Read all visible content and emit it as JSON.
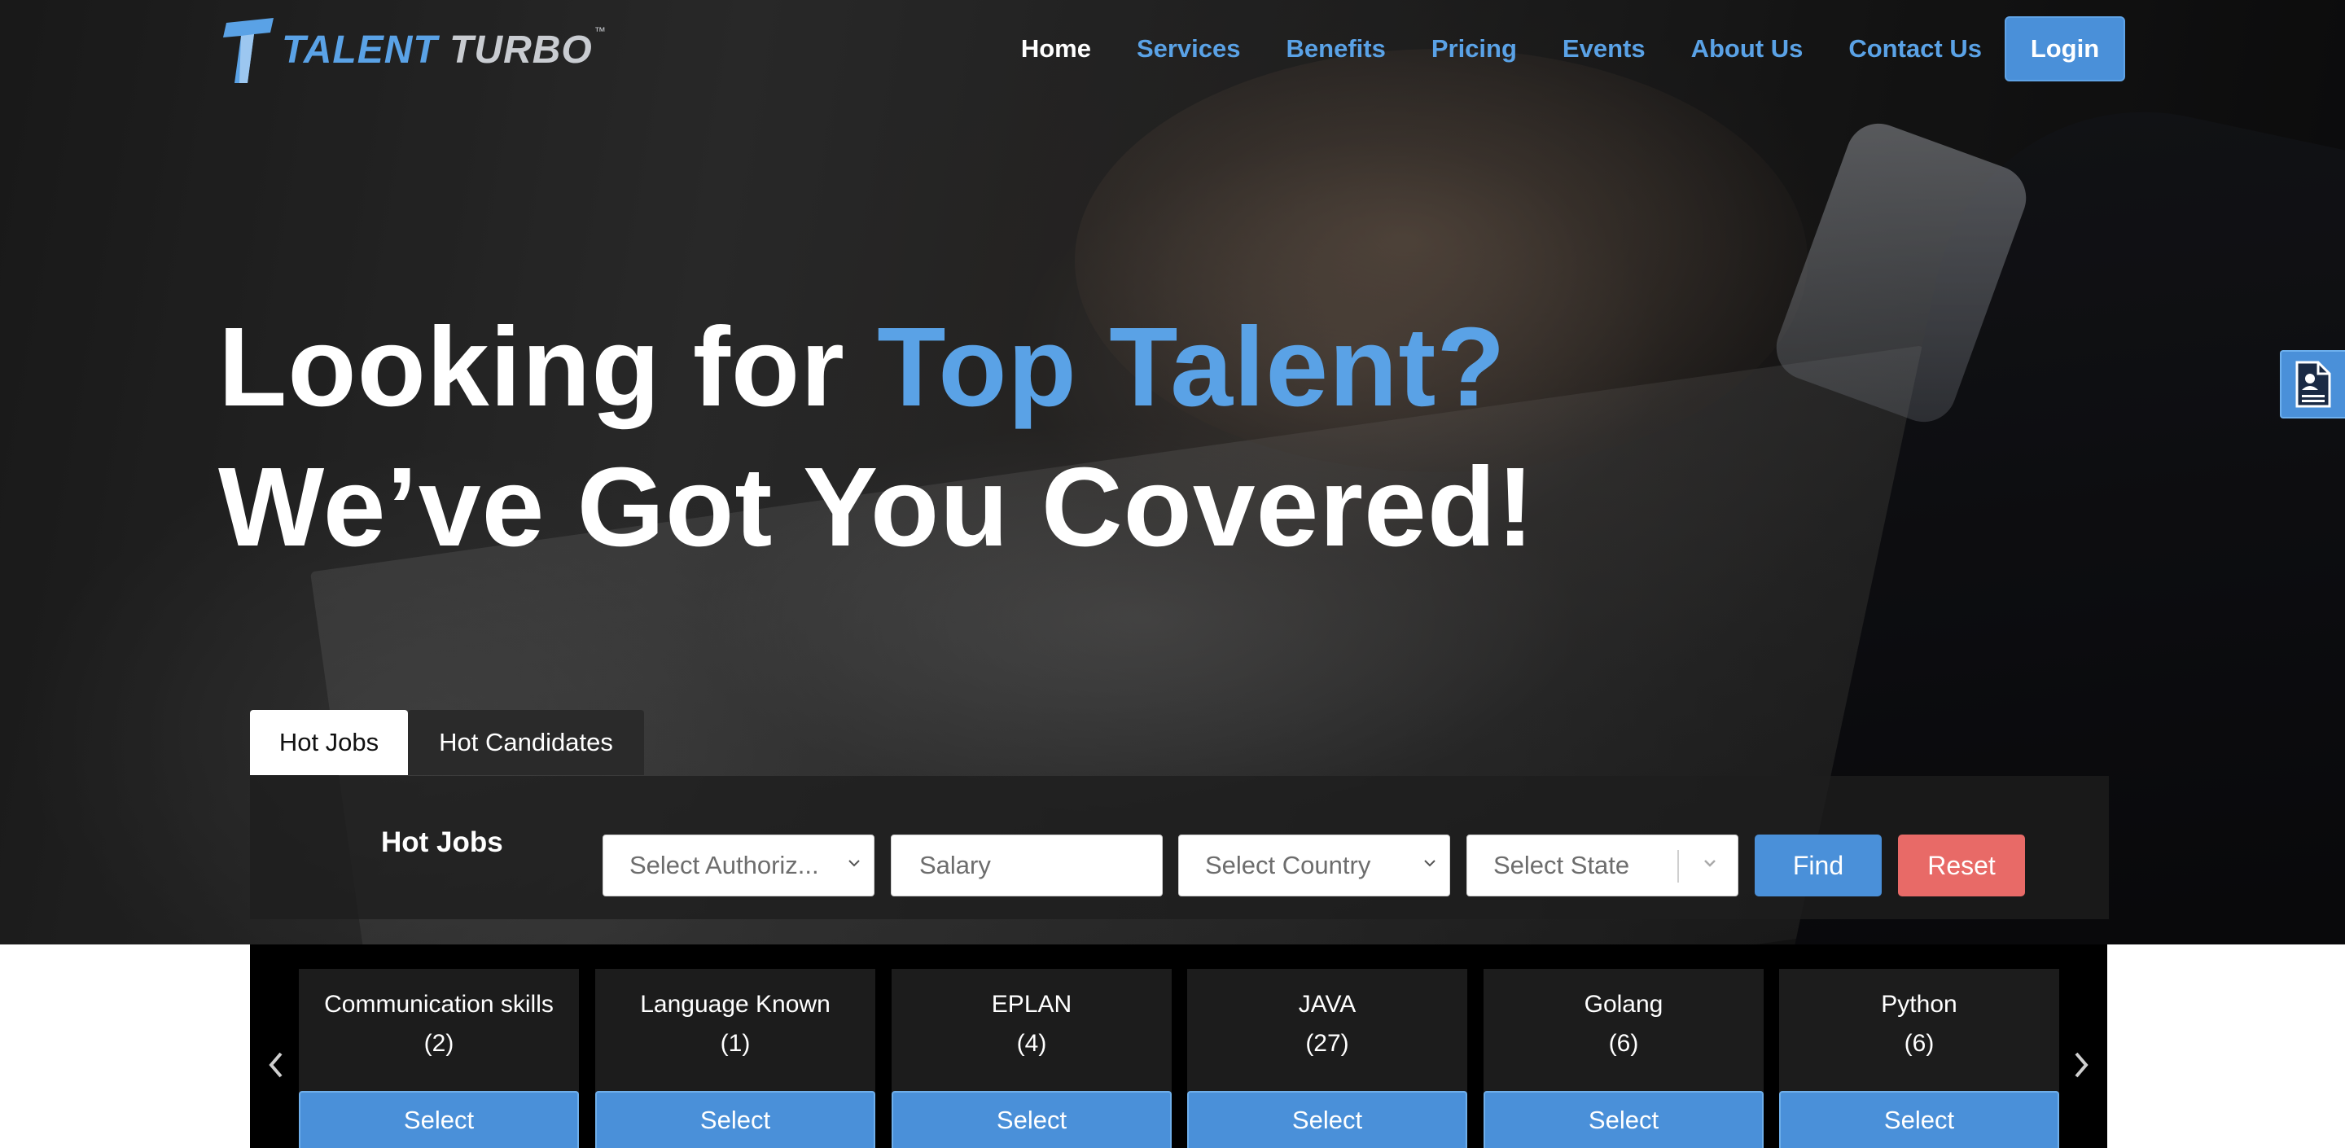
{
  "brand": {
    "logo_text_1": "TALENT",
    "logo_text_2": "TURBO",
    "trademark": "™",
    "accent_color": "#5aa2e6"
  },
  "nav": {
    "items": [
      "Home",
      "Services",
      "Benefits",
      "Pricing",
      "Events",
      "About Us",
      "Contact Us"
    ],
    "active": "Home",
    "login_label": "Login"
  },
  "hero": {
    "line1_prefix": "Looking for ",
    "line1_accent": "Top Talent?",
    "line2": "We’ve Got You Covered!"
  },
  "side_widget": {
    "icon": "document-icon"
  },
  "tabs": {
    "items": [
      "Hot Jobs",
      "Hot Candidates"
    ],
    "active": "Hot Jobs"
  },
  "filters": {
    "title": "Hot Jobs",
    "authorization_placeholder": "Select Authoriz...",
    "salary_placeholder": "Salary",
    "country_placeholder": "Select Country",
    "state_placeholder": "Select State",
    "find_label": "Find",
    "reset_label": "Reset",
    "find_color": "#4a90d9",
    "reset_color": "#e86a67"
  },
  "skills": {
    "items": [
      {
        "title": "Communication skills",
        "count": "(2)",
        "button": "Select"
      },
      {
        "title": "Language Known",
        "count": "(1)",
        "button": "Select"
      },
      {
        "title": "EPLAN",
        "count": "(4)",
        "button": "Select"
      },
      {
        "title": "JAVA",
        "count": "(27)",
        "button": "Select"
      },
      {
        "title": "Golang",
        "count": "(6)",
        "button": "Select"
      },
      {
        "title": "Python",
        "count": "(6)",
        "button": "Select"
      }
    ]
  }
}
